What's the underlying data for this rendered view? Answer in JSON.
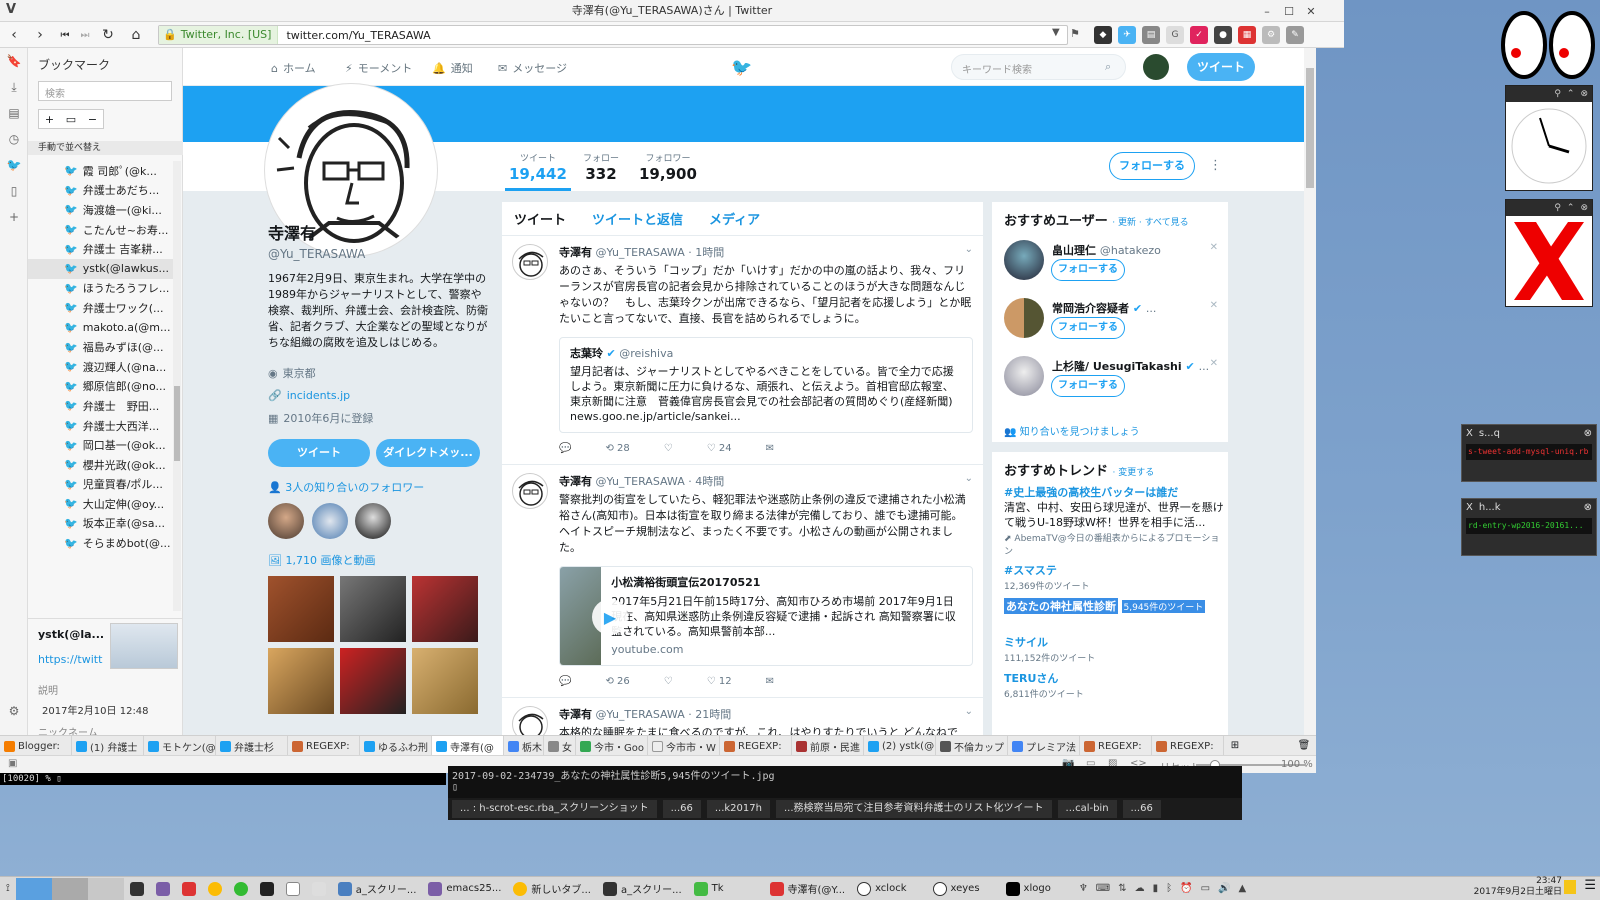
{
  "window": {
    "title": "寺澤有(@Yu_TERASAWA)さん | Twitter"
  },
  "browser": {
    "site_badge": "Twitter, Inc. [US]",
    "url": "twitter.com/Yu_TERASAWA"
  },
  "sidebar": {
    "title": "ブックマーク",
    "search_placeholder": "検索",
    "sort_label": "手動で並べ替え",
    "items": [
      "霞 司郎ﾟ(@k...",
      "弁護士あだち...",
      "海渡雄一(@ki...",
      "こたんせ~お寿...",
      "弁護士 吉峯耕...",
      "ystk(@lawkus...",
      "ほうたろうフレ...",
      "弁護士ワック(...",
      "makoto.a(@m...",
      "福島みずほ(@...",
      "渡辺輝人(@na...",
      "郷原信郎(@no...",
      "弁護士　野田...",
      "弁護士大西洋...",
      "岡口基一(@ok...",
      "櫻井光政(@ok...",
      "児童買春/ポル...",
      "大山定伸(@oy...",
      "坂本正幸(@sa...",
      "そらまめbot(@..."
    ],
    "detail_name": "ystk(@la...",
    "detail_link": "https://twitt",
    "detail_desc_label": "説明",
    "detail_nick_label": "ニックネーム",
    "detail_date": "2017年2月10日 12:48"
  },
  "twnav": {
    "home": "ホーム",
    "moments": "モーメント",
    "notifications": "通知",
    "messages": "メッセージ",
    "search_placeholder": "キーワード検索",
    "tweet_button": "ツイート"
  },
  "stats": {
    "tweets_label": "ツイート",
    "tweets": "19,442",
    "following_label": "フォロー",
    "following": "332",
    "followers_label": "フォロワー",
    "followers": "19,900",
    "follow_button": "フォローする"
  },
  "profile": {
    "name": "寺澤有",
    "handle": "@Yu_TERASAWA",
    "bio": "1967年2月9日、東京生まれ。大学在学中の1989年からジャーナリストとして、警察や検察、裁判所、弁護士会、会計検査院、防衛省、記者クラブ、大企業などの聖域となりがちな組織の腐敗を追及しはじめる。",
    "location": "東京都",
    "url": "incidents.jp",
    "joined": "2010年6月に登録",
    "tweet_button": "ツイート",
    "dm_button": "ダイレクトメッ...",
    "known_followers": "3人の知り合いのフォロワー",
    "media": "1,710 画像と動画"
  },
  "timeline": {
    "tabs": [
      "ツイート",
      "ツイートと返信",
      "メディア"
    ],
    "tweets": [
      {
        "name": "寺澤有",
        "handle": "@Yu_TERASAWA · 1時間",
        "text": "あのさぁ、そういう「コップ」だか「いけす」だかの中の嵐の話より、我々、フリーランスが官房長官の記者会見から排除されていることのほうが大きな問題なんじゃないの？　もし、志葉玲クンが出席できるなら、「望月記者を応援しよう」とか眠たいこと言ってないで、直接、長官を詰められるでしょうに。",
        "quote_name": "志葉玲",
        "quote_handle": "@reishiva",
        "quote_text": "望月記者は、ジャーナリストとしてやるべきことをしている。皆で全力で応援しよう。東京新聞に圧力に負けるな、頑張れ、と伝えよう。首相官邸広報室、東京新聞に注意　菅義偉官房長官会見での社会部記者の質問めぐり(産経新聞)  news.goo.ne.jp/article/sankei...",
        "retweets": "28",
        "likes": "24"
      },
      {
        "name": "寺澤有",
        "handle": "@Yu_TERASAWA · 4時間",
        "text": "警察批判の街宣をしていたら、軽犯罪法や迷惑防止条例の違反で逮捕された小松満裕さん(高知市)。日本は街宣を取り締まる法律が完備しており、誰でも逮捕可能。ヘイトスピーチ規制法など、まったく不要です。小松さんの動画が公開されました。",
        "card_title": "小松満裕街頭宣伝20170521",
        "card_text": "2017年5月21日午前15時17分、高知市ひろめ市場前 2017年9月1日現在、高知県迷惑防止条例違反容疑で逮捕・起訴され 高知警察署に収監されている。高知県警前本部...",
        "card_domain": "youtube.com",
        "retweets": "26",
        "likes": "12"
      },
      {
        "name": "寺澤有",
        "handle": "@Yu_TERASAWA · 21時間",
        "text": "本格的な睡眠をたまに食べるのですが、これ、はやりすたりでいうと どんなねでし..."
      }
    ]
  },
  "wtf": {
    "title": "おすすめユーザー",
    "links": "· 更新 · すべて見る",
    "users": [
      {
        "name": "畠山理仁",
        "handle": "@hatakezo",
        "button": "フォローする"
      },
      {
        "name": "常岡浩介容疑者",
        "handle": "...",
        "button": "フォローする"
      },
      {
        "name": "上杉隆/ UesugiTakashi",
        "handle": "...",
        "button": "フォローする"
      }
    ],
    "find_friends": "知り合いを見つけましょう"
  },
  "trends": {
    "title": "おすすめトレンド",
    "change": "· 変更する",
    "items": [
      {
        "tag": "#史上最強の高校生バッターは誰だ",
        "desc": "清宮、中村、安田ら球児達が、世界一を懸けて戦うU-18野球W杯！世界を相手に活...",
        "count": "AbemaTV@今日の番組表からによるプロモーション"
      },
      {
        "tag": "#スマステ",
        "desc": "",
        "count": "12,369件のツイート"
      },
      {
        "tag": "あなたの神社属性診断",
        "desc": "",
        "count": "5,945件のツイート"
      },
      {
        "tag": "ミサイル",
        "desc": "",
        "count": "111,152件のツイート"
      },
      {
        "tag": "TERUさん",
        "desc": "",
        "count": "6,811件のツイート"
      }
    ]
  },
  "tabs": [
    "Blogger:",
    "(1) 弁護士",
    "モトケン(@",
    "弁護士杉",
    "REGEXP:",
    "ゆるふわ刑",
    "寺澤有(@",
    "栃木",
    "女",
    "今市・Goo",
    "今市市・W",
    "REGEXP:",
    "前原・民進",
    "(2) ystk(@",
    "不倫カップ",
    "プレミア法",
    "REGEXP:",
    "REGEXP:"
  ],
  "status": {
    "reset": "リセット",
    "zoom": "100 %"
  },
  "terminal": {
    "prompt": "[10020]  %",
    "filename": "2017-09-02-234739_あなたの神社属性診断5,945件のツイート.jpg",
    "tabs": [
      "... : h-scrot-esc.rba_スクリーンショット",
      "...66",
      "...k2017h",
      "...務検察当局宛て注目参考資料弁護士のリスト化ツイート",
      "...cal-bin",
      "...66"
    ]
  },
  "mini_terms": [
    {
      "title": "s...q",
      "line": "s-tweet-add-mysql-uniq.rb"
    },
    {
      "title": "h...k",
      "line": "rd-entry-wp2016-20161..."
    }
  ],
  "taskbar": {
    "items": [
      "a_スクリー...",
      "emacs25...",
      "新しいタブ...",
      "a_スクリー...",
      "Tk",
      "寺澤有(@Y...",
      "xclock",
      "xeyes",
      "xlogo"
    ],
    "time": "23:47",
    "date": "2017年9月2日土曜日"
  }
}
